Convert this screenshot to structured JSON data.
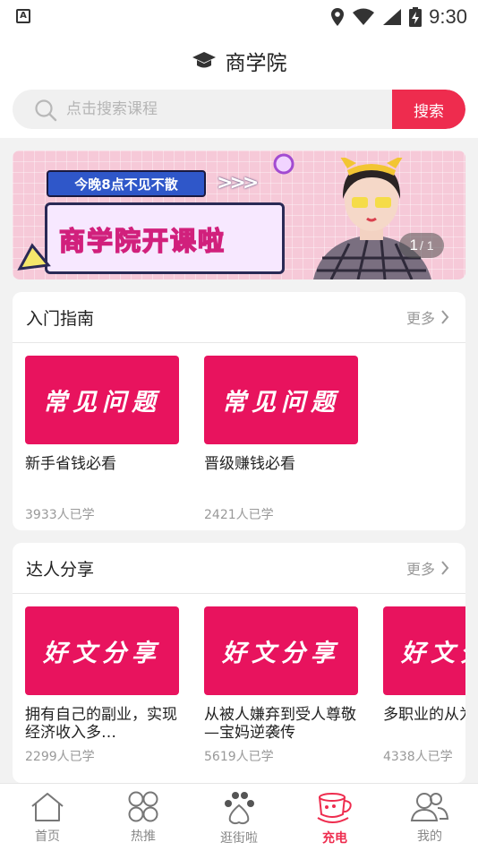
{
  "status_bar": {
    "time": "9:30",
    "left_badge": "A"
  },
  "header": {
    "title": "商学院"
  },
  "search": {
    "placeholder": "点击搜索课程",
    "value": "",
    "button_label": "搜索"
  },
  "banner": {
    "tag_text": "今晚8点不见不散",
    "headline": "商学院开课啦",
    "pager_current": "1",
    "pager_total": "/ 1"
  },
  "sections": [
    {
      "title": "入门指南",
      "more_label": "更多",
      "items": [
        {
          "thumb_text": "常见问题",
          "name": "新手省钱必看",
          "count": "3933人已学"
        },
        {
          "thumb_text": "常见问题",
          "name": "晋级赚钱必看",
          "count": "2421人已学"
        }
      ]
    },
    {
      "title": "达人分享",
      "more_label": "更多",
      "items": [
        {
          "thumb_text": "好文分享",
          "name": "拥有自己的副业，实现经济收入多…",
          "count": "2299人已学"
        },
        {
          "thumb_text": "好文分享",
          "name": "从被人嫌弃到受人尊敬—宝妈逆袭传",
          "count": "5619人已学"
        },
        {
          "thumb_text": "好文分享",
          "name": "多职业的从为何最终逆",
          "count": "4338人已学"
        }
      ]
    }
  ],
  "tabbar": {
    "items": [
      {
        "label": "首页",
        "icon": "home-icon"
      },
      {
        "label": "热推",
        "icon": "hot-grid-icon"
      },
      {
        "label": "逛街啦",
        "icon": "paw-icon"
      },
      {
        "label": "充电",
        "icon": "coffee-cup-icon"
      },
      {
        "label": "我的",
        "icon": "user-icon"
      }
    ],
    "active_index": 3
  },
  "colors": {
    "accent": "#ee2c4e",
    "thumb_bg": "#e8135e",
    "inactive": "#888888"
  }
}
